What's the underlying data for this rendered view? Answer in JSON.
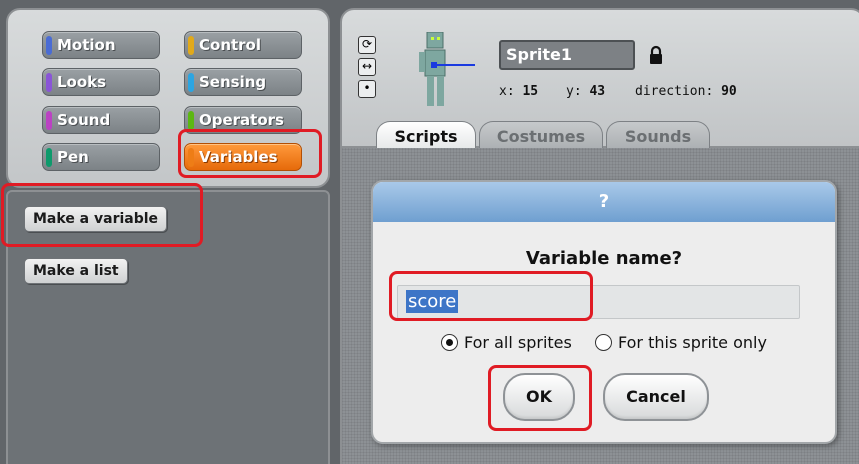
{
  "palette": {
    "categories": [
      {
        "label": "Motion",
        "color": "#4a6cd4"
      },
      {
        "label": "Control",
        "color": "#e1a91a"
      },
      {
        "label": "Looks",
        "color": "#8a55d7"
      },
      {
        "label": "Sensing",
        "color": "#2ca5e2"
      },
      {
        "label": "Sound",
        "color": "#bb42c3"
      },
      {
        "label": "Operators",
        "color": "#5cb712"
      },
      {
        "label": "Pen",
        "color": "#0e9a6c"
      },
      {
        "label": "Variables",
        "color": "#ee7d16"
      }
    ],
    "selected": "Variables"
  },
  "blocks": {
    "make_variable": "Make a variable",
    "make_list": "Make a list"
  },
  "sprite": {
    "name": "Sprite1",
    "x_label": "x:",
    "x_value": "15",
    "y_label": "y:",
    "y_value": "43",
    "direction_label": "direction:",
    "direction_value": "90"
  },
  "tabs": [
    "Scripts",
    "Costumes",
    "Sounds"
  ],
  "active_tab": "Scripts",
  "dialog": {
    "title": "?",
    "prompt": "Variable name?",
    "input_value": "score",
    "options": [
      "For all sprites",
      "For this sprite only"
    ],
    "selected_option": "For all sprites",
    "ok_label": "OK",
    "cancel_label": "Cancel"
  },
  "colors": {
    "highlight": "#e01b24",
    "dialog_title": "#8ab4de",
    "active_category": "#ee7d16"
  }
}
